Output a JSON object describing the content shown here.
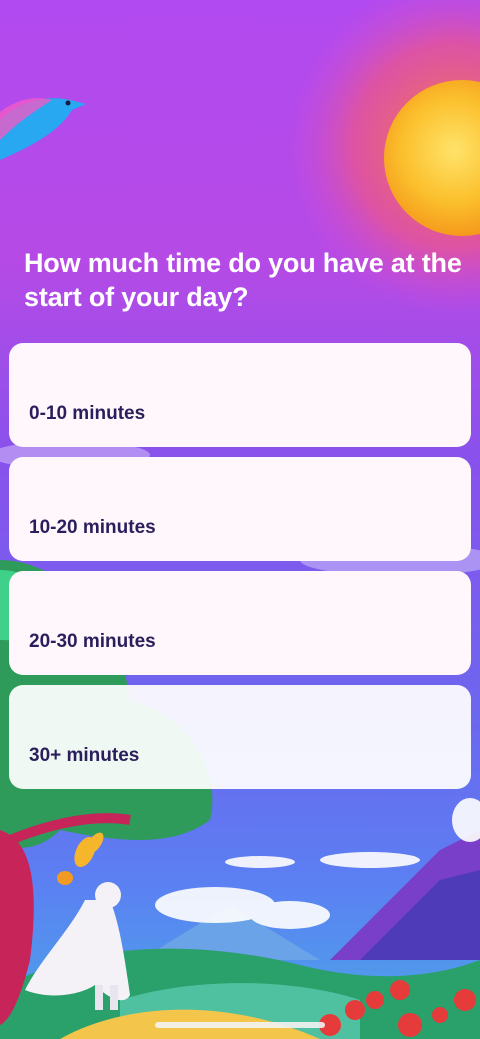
{
  "question": "How much time do you have at the start of your day?",
  "options": [
    {
      "label": "0-10 minutes"
    },
    {
      "label": "10-20 minutes"
    },
    {
      "label": "20-30 minutes"
    },
    {
      "label": "30+ minutes"
    }
  ],
  "illustration": {
    "elements": [
      "sun",
      "bluebird-icon",
      "tree",
      "caped-figure",
      "butterfly-icon",
      "mountains",
      "clouds",
      "flowers"
    ],
    "colors": {
      "sky_top": "#b14af0",
      "sky_mid": "#7a58ef",
      "sky_low": "#5f7cf1",
      "sun": "#f7b52a",
      "grass": "#2aa06b",
      "path": "#f3c54a"
    }
  }
}
